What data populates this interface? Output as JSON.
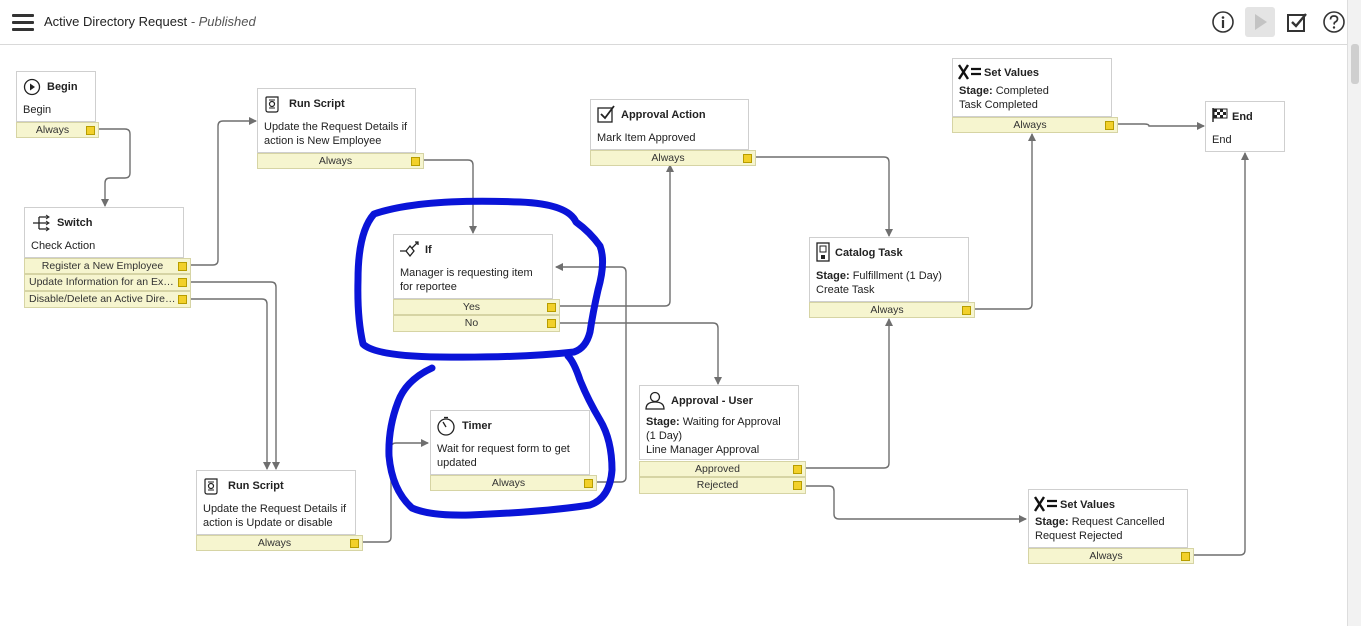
{
  "header": {
    "title": "Active Directory Request",
    "status": "- Published",
    "icons": [
      "menu-icon",
      "info-icon",
      "play-icon",
      "checkbox-icon",
      "help-icon"
    ]
  },
  "activities": {
    "begin": {
      "title": "Begin",
      "body": "Begin",
      "exits": [
        "Always"
      ]
    },
    "run_script_1": {
      "title": "Run Script",
      "body": "Update the Request Details if action is New Employee",
      "exits": [
        "Always"
      ]
    },
    "switch": {
      "title": "Switch",
      "body": "Check Action",
      "exits": [
        "Register a New Employee",
        "Update Information for an Existi..",
        "Disable/Delete an Active Directo.."
      ]
    },
    "if": {
      "title": "If",
      "body": "Manager is requesting item for reportee",
      "exits": [
        "Yes",
        "No"
      ]
    },
    "approval_action": {
      "title": "Approval Action",
      "body": "Mark Item Approved",
      "exits": [
        "Always"
      ]
    },
    "catalog_task": {
      "title": "Catalog Task",
      "stage_label": "Stage:",
      "stage_value": "Fulfillment (1 Day)",
      "body": "Create Task",
      "exits": [
        "Always"
      ]
    },
    "set_values_1": {
      "title": "Set Values",
      "stage_label": "Stage:",
      "stage_value": "Completed",
      "body": "Task Completed",
      "exits": [
        "Always"
      ]
    },
    "end": {
      "title": "End",
      "body": "End"
    },
    "timer": {
      "title": "Timer",
      "body": "Wait for request form to get updated",
      "exits": [
        "Always"
      ]
    },
    "approval_user": {
      "title": "Approval - User",
      "stage_label": "Stage:",
      "stage_value": "Waiting for Approval (1 Day)",
      "body": "Line Manager Approval",
      "exits": [
        "Approved",
        "Rejected"
      ]
    },
    "run_script_2": {
      "title": "Run Script",
      "body": "Update the Request Details if action is Update or disable",
      "exits": [
        "Always"
      ]
    },
    "set_values_2": {
      "title": "Set Values",
      "stage_label": "Stage:",
      "stage_value": "Request Cancelled",
      "body": "Request Rejected",
      "exits": [
        "Always"
      ]
    }
  },
  "colors": {
    "connector_line": "#6f6f6f",
    "exit_bg": "#f6f5cf",
    "exit_connector": "#f2d02a",
    "annotation": "#0a14d8"
  }
}
